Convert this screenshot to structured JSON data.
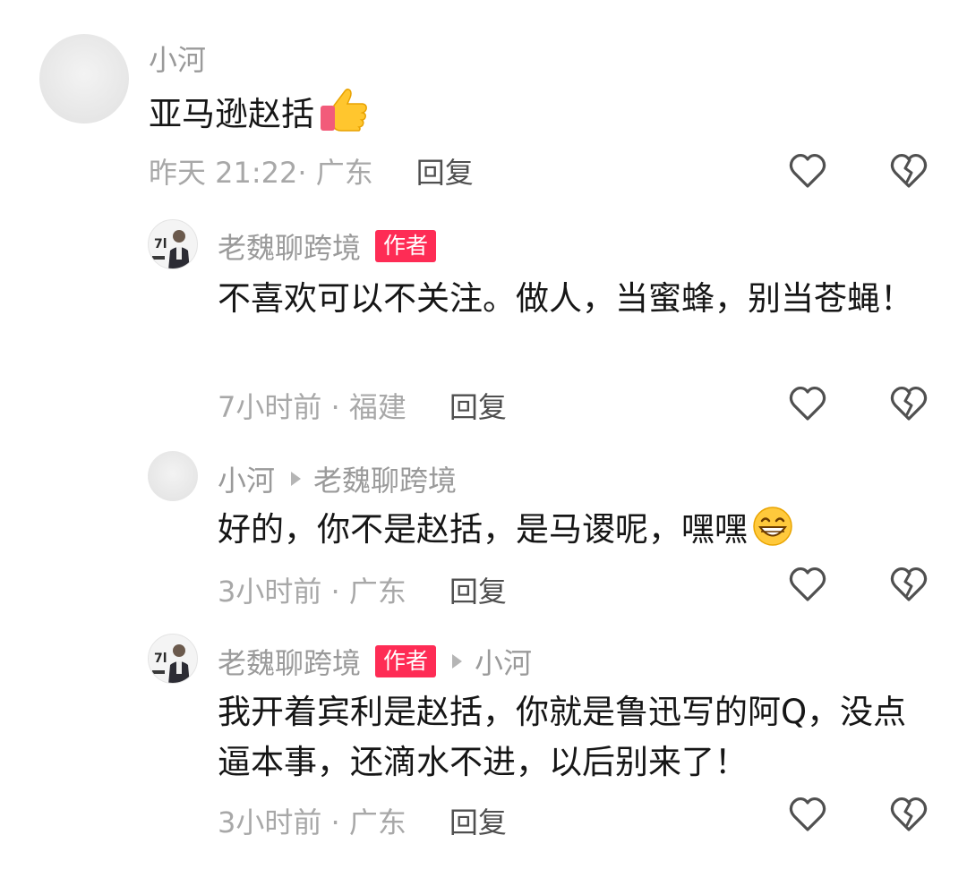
{
  "comments": [
    {
      "username": "小河",
      "text": "亚马逊赵括",
      "emoji": "thumbs-up-icon",
      "time_location": "昨天 21:22· 广东",
      "reply_label": "回复"
    },
    {
      "username": "老魏聊跨境",
      "badge": "作者",
      "text": "不喜欢可以不关注。做人，当蜜蜂，别当苍蝇！",
      "time_location": "7小时前 · 福建",
      "reply_label": "回复"
    },
    {
      "username": "小河",
      "reply_to": "老魏聊跨境",
      "text": "好的，你不是赵括，是马谡呢，嘿嘿",
      "emoji": "grinning-face-icon",
      "time_location": "3小时前 · 广东",
      "reply_label": "回复"
    },
    {
      "username": "老魏聊跨境",
      "badge": "作者",
      "reply_to": "小河",
      "text": "我开着宾利是赵括，你就是鲁迅写的阿Q，没点逼本事，还滴水不进，以后别来了！",
      "time_location": "3小时前 · 广东",
      "reply_label": "回复"
    }
  ],
  "colors": {
    "author_badge": "#fe2c55",
    "username": "#9a9a9a",
    "meta": "#a8a8a8",
    "icon": "#505050"
  },
  "icons": {
    "like": "heart-icon",
    "dislike": "broken-heart-icon"
  }
}
